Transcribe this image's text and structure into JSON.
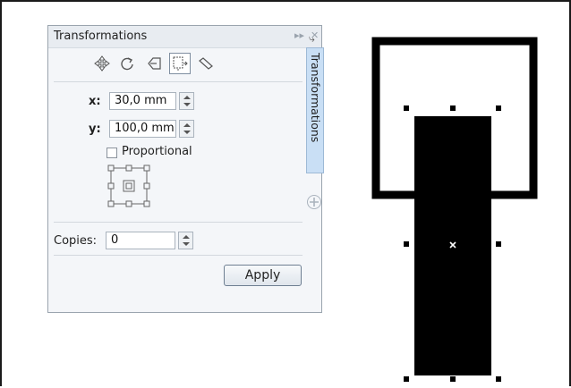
{
  "docker": {
    "title": "Transformations",
    "x_label": "x:",
    "x_value": "30,0 mm",
    "y_label": "y:",
    "y_value": "100,0 mm",
    "proportional_label": "Proportional",
    "proportional_checked": false,
    "copies_label": "Copies:",
    "copies_value": "0",
    "apply_label": "Apply",
    "side_tab_label": "Transformations",
    "tools": [
      "position-icon",
      "rotate-icon",
      "scale-icon",
      "size-icon",
      "skew-icon"
    ],
    "active_tool": "size-icon"
  },
  "colors": {
    "panel_bg": "#f4f6f9",
    "side_tab_bg": "#c9dff5",
    "object_fill": "#000000",
    "outline_stroke": "#000000"
  }
}
